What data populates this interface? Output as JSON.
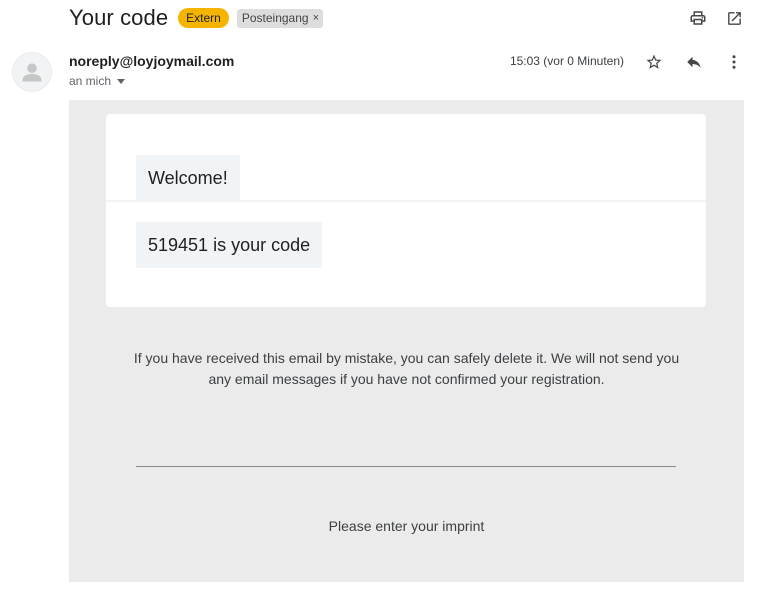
{
  "header": {
    "subject": "Your code",
    "badge_external": "Extern",
    "label_inbox": "Posteingang",
    "label_remove": "×",
    "icons": [
      "print-icon",
      "open-in-new-window-icon"
    ]
  },
  "message": {
    "sender": "noreply@loyjoymail.com",
    "recipient": "an mich",
    "timestamp": "15:03 (vor 0 Minuten)",
    "icons": [
      "star-icon",
      "reply-icon",
      "more-vert-icon"
    ]
  },
  "body": {
    "welcome": "Welcome!",
    "code_line": "519451 is your code",
    "disclaimer": "If you have received this email by mistake, you can safely delete it. We will not send you any email messages if you have not confirmed your registration.",
    "imprint": "Please enter your imprint"
  },
  "colors": {
    "badge_extern": "#f4b400",
    "body_background": "#ebebeb",
    "bubble_background": "#f1f4f7"
  }
}
